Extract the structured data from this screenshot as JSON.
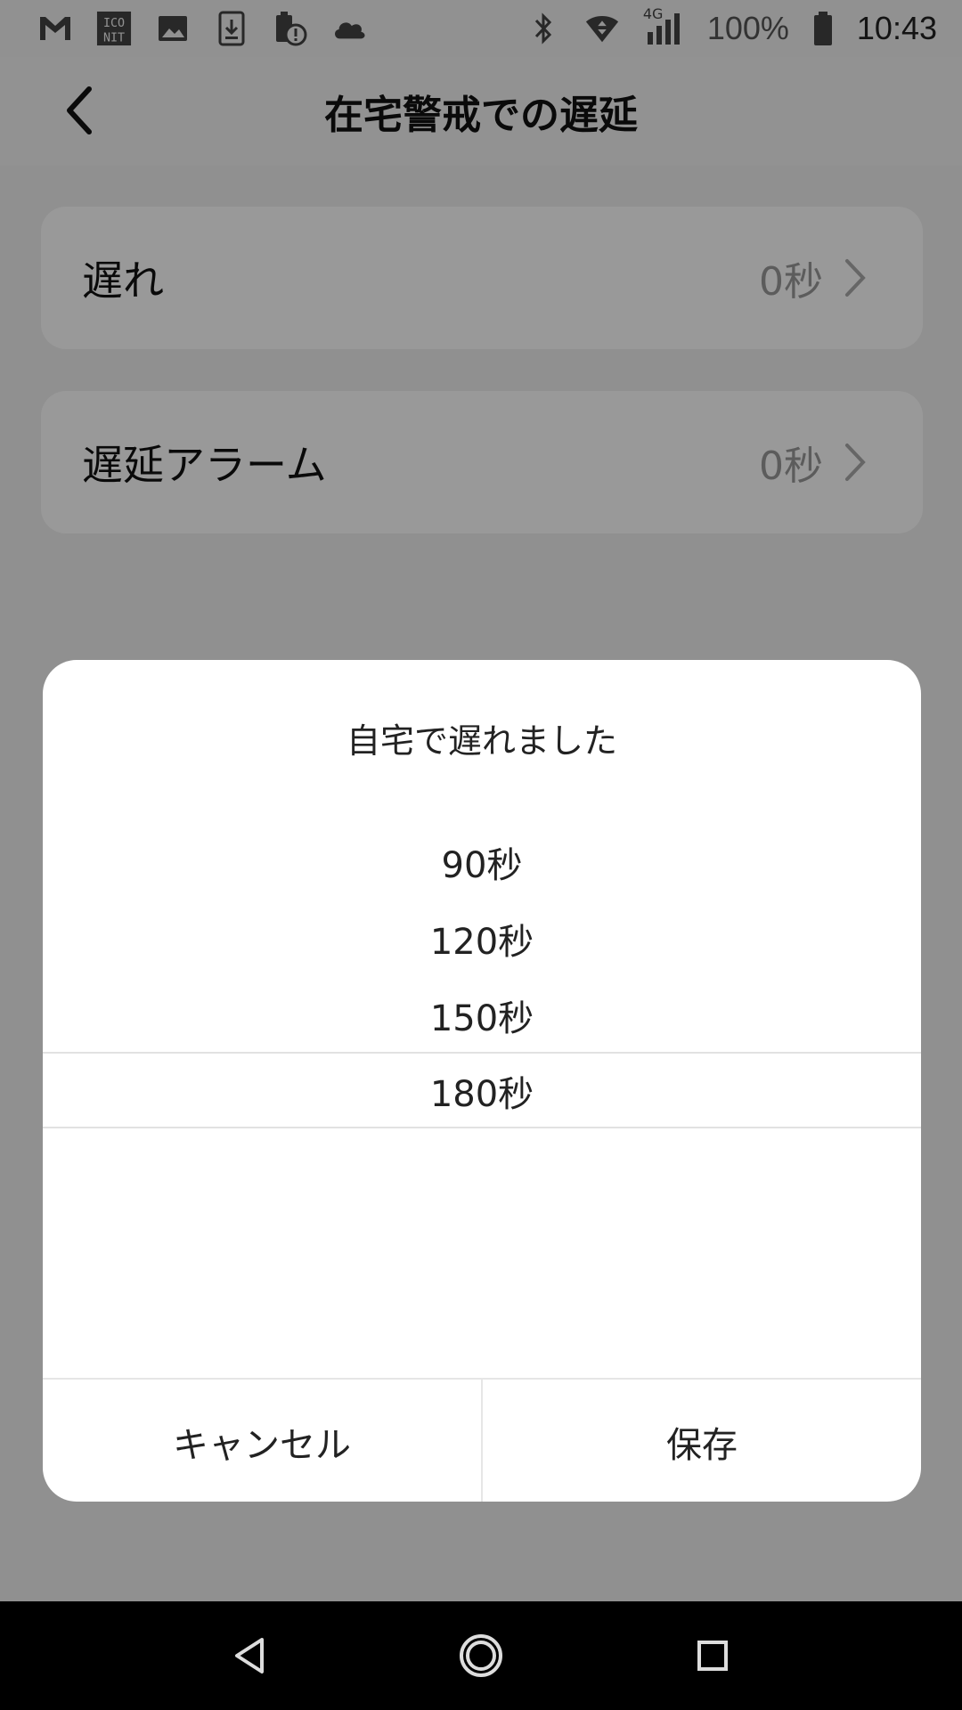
{
  "status_bar": {
    "battery": "100%",
    "time": "10:43",
    "network": "4G",
    "icons_left": [
      "gmail-icon",
      "iconit-icon",
      "image-icon",
      "download-icon",
      "battery-alert-icon",
      "cloud-icon"
    ],
    "icons_right": [
      "bluetooth-icon",
      "wifi-icon",
      "signal-icon",
      "battery-icon"
    ]
  },
  "header": {
    "title": "在宅警戒での遅延",
    "back_icon": "chevron-left-icon"
  },
  "settings": [
    {
      "label": "遅れ",
      "value": "0秒"
    },
    {
      "label": "遅延アラーム",
      "value": "0秒"
    }
  ],
  "dialog": {
    "title": "自宅で遅れました",
    "options": [
      "90秒",
      "120秒",
      "150秒",
      "180秒"
    ],
    "selected": "180秒",
    "cancel_label": "キャンセル",
    "save_label": "保存"
  },
  "nav": {
    "icons": [
      "back-triangle-icon",
      "home-circle-icon",
      "recents-square-icon"
    ]
  },
  "colors": {
    "overlay": "#000000",
    "dialog_bg": "#ffffff",
    "divider": "#e2e2e2"
  }
}
